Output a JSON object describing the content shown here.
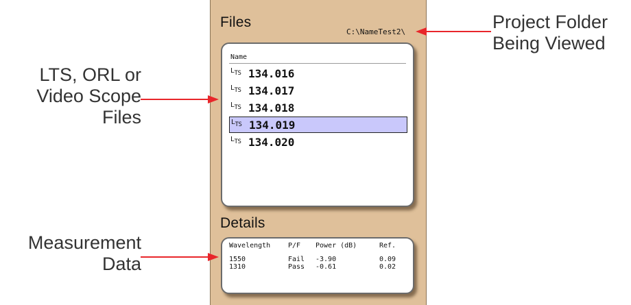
{
  "callouts": {
    "project_folder": [
      "Project Folder",
      "Being Viewed"
    ],
    "files_type": [
      "LTS, ORL or",
      "Video Scope",
      "Files"
    ],
    "measurement": [
      "Measurement",
      "Data"
    ]
  },
  "files_panel": {
    "title": "Files",
    "folder_path": "C:\\NameTest2\\",
    "column_header": "Name",
    "file_icon_label": "LTS",
    "files": [
      {
        "name": "134.016",
        "selected": false
      },
      {
        "name": "134.017",
        "selected": false
      },
      {
        "name": "134.018",
        "selected": false
      },
      {
        "name": "134.019",
        "selected": true
      },
      {
        "name": "134.020",
        "selected": false
      }
    ]
  },
  "details_panel": {
    "title": "Details",
    "headers": [
      "Wavelength",
      "P/F",
      "Power (dB)",
      "Ref."
    ],
    "rows": [
      [
        "1550",
        "Fail",
        "-3.90",
        "0.09"
      ],
      [
        "1310",
        "Pass",
        "-0.61",
        "0.02"
      ]
    ]
  },
  "colors": {
    "device_bg": "#dfc09a",
    "selection": "#c9c8fb",
    "arrow": "#e8262a"
  }
}
